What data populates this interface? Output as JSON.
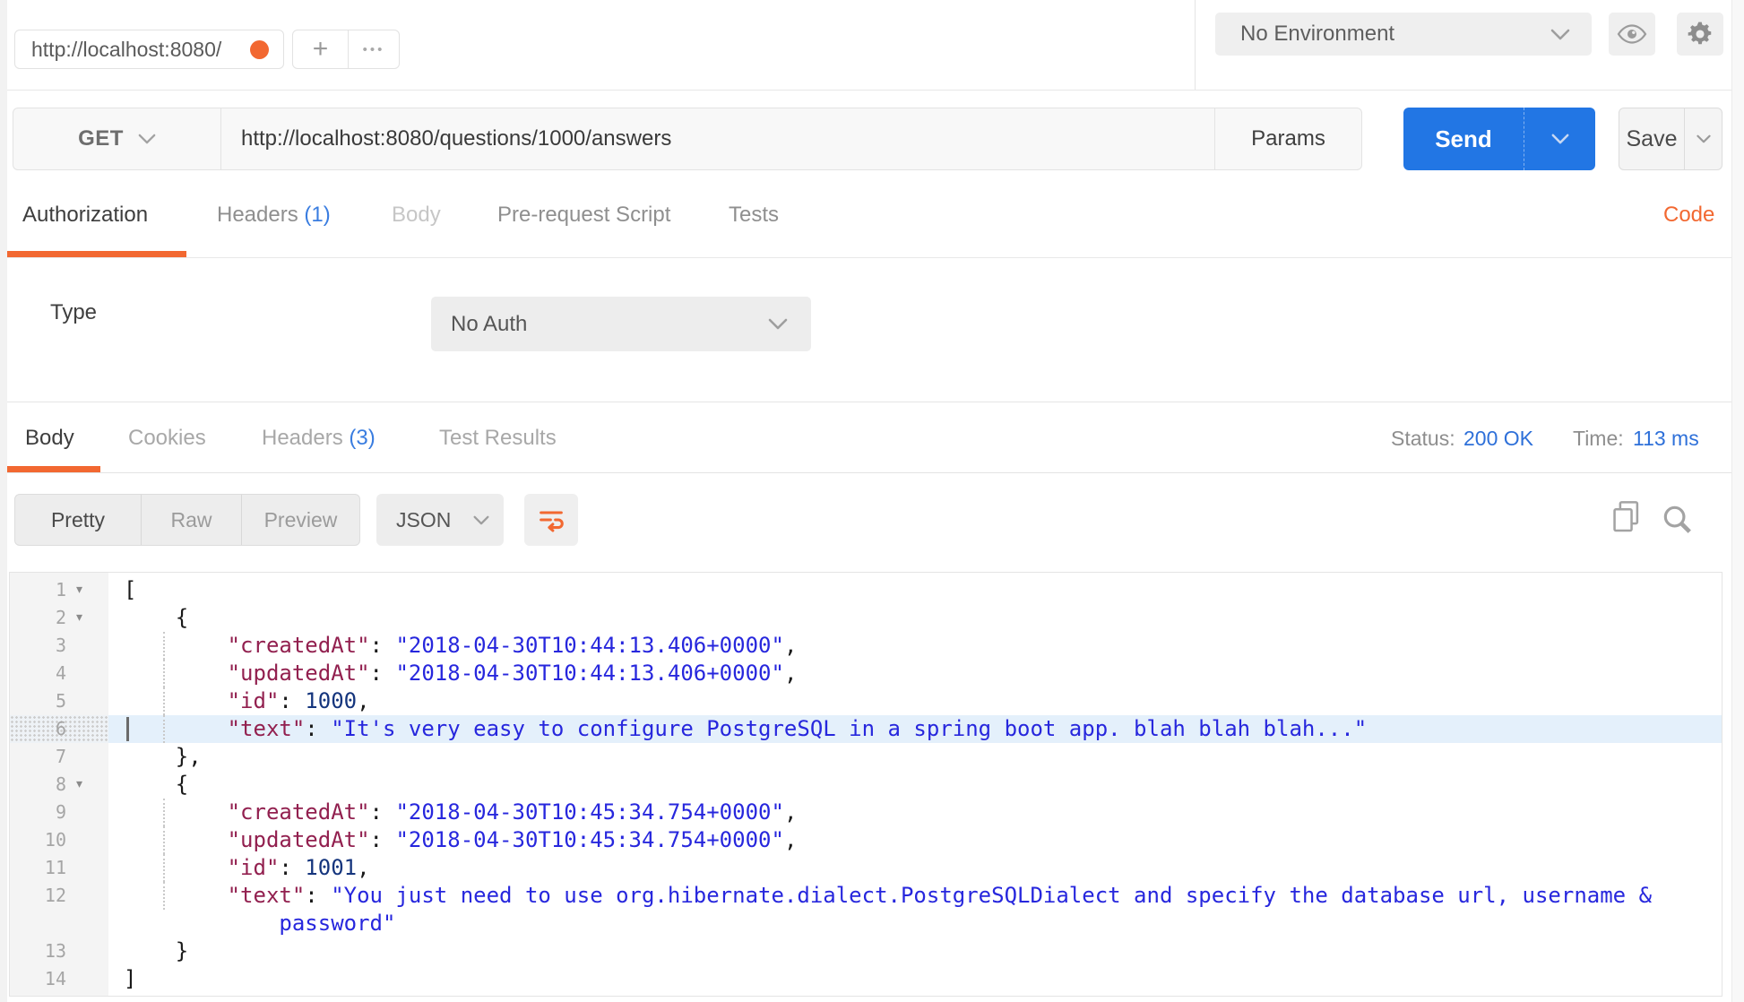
{
  "topbar": {
    "tab_title": "http://localhost:8080/",
    "new_tab_label": "+",
    "more_tabs_label": "•••",
    "environment_selector": "No Environment"
  },
  "request": {
    "method": "GET",
    "url": "http://localhost:8080/questions/1000/answers",
    "params_label": "Params",
    "send_label": "Send",
    "save_label": "Save"
  },
  "request_tabs": {
    "authorization": "Authorization",
    "headers": "Headers",
    "headers_count": "(1)",
    "body": "Body",
    "pre_request": "Pre-request Script",
    "tests": "Tests",
    "code_link": "Code"
  },
  "authorization": {
    "type_label": "Type",
    "type_value": "No Auth"
  },
  "response": {
    "body_tab": "Body",
    "cookies_tab": "Cookies",
    "headers_tab": "Headers",
    "headers_count": "(3)",
    "test_results_tab": "Test Results",
    "status_label": "Status:",
    "status_value": "200 OK",
    "time_label": "Time:",
    "time_value": "113 ms",
    "pretty": "Pretty",
    "raw": "Raw",
    "preview": "Preview",
    "language": "JSON"
  },
  "colors": {
    "accent_orange": "#f26831",
    "send_blue": "#2276e4",
    "link_blue": "#2e70d9",
    "count_blue": "#3a7de0",
    "json_key": "#92204f",
    "json_string": "#2727dd",
    "json_number": "#15357d",
    "line_highlight": "#e4f0fb"
  },
  "code": {
    "fold_arrow": "▾",
    "lines": [
      {
        "n": "1",
        "fold": true,
        "tokens": [
          [
            "p",
            "["
          ]
        ]
      },
      {
        "n": "2",
        "fold": true,
        "tokens": [
          [
            "p",
            "    {"
          ]
        ]
      },
      {
        "n": "3",
        "guide": true,
        "tokens": [
          [
            "p",
            "        "
          ],
          [
            "k",
            "\"createdAt\""
          ],
          [
            "p",
            ": "
          ],
          [
            "s",
            "\"2018-04-30T10:44:13.406+0000\""
          ],
          [
            "p",
            ","
          ]
        ]
      },
      {
        "n": "4",
        "guide": true,
        "tokens": [
          [
            "p",
            "        "
          ],
          [
            "k",
            "\"updatedAt\""
          ],
          [
            "p",
            ": "
          ],
          [
            "s",
            "\"2018-04-30T10:44:13.406+0000\""
          ],
          [
            "p",
            ","
          ]
        ]
      },
      {
        "n": "5",
        "guide": true,
        "tokens": [
          [
            "p",
            "        "
          ],
          [
            "k",
            "\"id\""
          ],
          [
            "p",
            ": "
          ],
          [
            "num",
            "1000"
          ],
          [
            "p",
            ","
          ]
        ]
      },
      {
        "n": "6",
        "guide": true,
        "hl": true,
        "caret": true,
        "tokens": [
          [
            "p",
            "        "
          ],
          [
            "k",
            "\"text\""
          ],
          [
            "p",
            ": "
          ],
          [
            "s",
            "\"It's very easy to configure PostgreSQL in a spring boot app. blah blah blah...\""
          ]
        ]
      },
      {
        "n": "7",
        "tokens": [
          [
            "p",
            "    },"
          ]
        ]
      },
      {
        "n": "8",
        "fold": true,
        "tokens": [
          [
            "p",
            "    {"
          ]
        ]
      },
      {
        "n": "9",
        "guide": true,
        "tokens": [
          [
            "p",
            "        "
          ],
          [
            "k",
            "\"createdAt\""
          ],
          [
            "p",
            ": "
          ],
          [
            "s",
            "\"2018-04-30T10:45:34.754+0000\""
          ],
          [
            "p",
            ","
          ]
        ]
      },
      {
        "n": "10",
        "guide": true,
        "tokens": [
          [
            "p",
            "        "
          ],
          [
            "k",
            "\"updatedAt\""
          ],
          [
            "p",
            ": "
          ],
          [
            "s",
            "\"2018-04-30T10:45:34.754+0000\""
          ],
          [
            "p",
            ","
          ]
        ]
      },
      {
        "n": "11",
        "guide": true,
        "tokens": [
          [
            "p",
            "        "
          ],
          [
            "k",
            "\"id\""
          ],
          [
            "p",
            ": "
          ],
          [
            "num",
            "1001"
          ],
          [
            "p",
            ","
          ]
        ]
      },
      {
        "n": "12",
        "guide": true,
        "tokens": [
          [
            "p",
            "        "
          ],
          [
            "k",
            "\"text\""
          ],
          [
            "p",
            ": "
          ],
          [
            "s",
            "\"You just need to use org.hibernate.dialect.PostgreSQLDialect and specify the database url, username &"
          ]
        ]
      },
      {
        "n": "",
        "cont": true,
        "tokens": [
          [
            "p",
            "            "
          ],
          [
            "s",
            "password\""
          ]
        ]
      },
      {
        "n": "13",
        "tokens": [
          [
            "p",
            "    }"
          ]
        ]
      },
      {
        "n": "14",
        "tokens": [
          [
            "p",
            "]"
          ]
        ]
      }
    ]
  }
}
